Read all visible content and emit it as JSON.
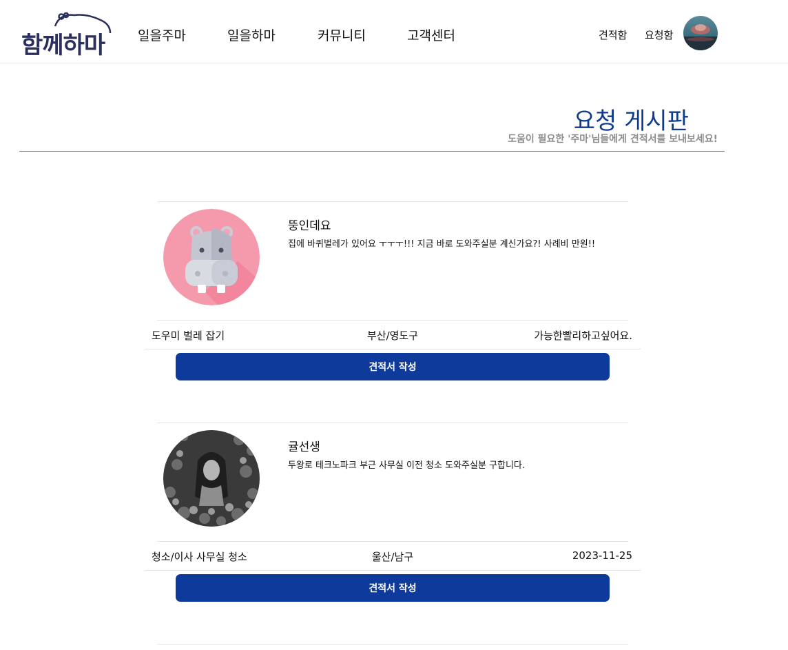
{
  "header": {
    "logo_text": "함께하마",
    "nav": [
      "일을주마",
      "일을하마",
      "커뮤니티",
      "고객센터"
    ],
    "util": [
      "견적함",
      "요청함"
    ]
  },
  "board": {
    "title": "요청 게시판",
    "subtitle": "도움이 필요한 '주마'님들에게 견적서를 보내보세요!"
  },
  "requests": [
    {
      "name": "뚱인데요",
      "description": "집에 바퀴벌레가 있어요 ㅜㅜㅜ!!! 지금 바로 도와주실분 계신가요?! 사례비 만원!!",
      "category": "도우미 벌레 잡기",
      "location": "부산/영도구",
      "time": "가능한빨리하고싶어요.",
      "button_label": "견적서 작성",
      "photo_icon": "hippo-icon"
    },
    {
      "name": "귤선생",
      "description": "두왕로 테크노파크 부근 사무실 이전 청소 도와주실분 구합니다.",
      "category": "청소/이사 사무실 청소",
      "location": "울산/남구",
      "time": "2023-11-25",
      "button_label": "견적서 작성",
      "photo_icon": "user-photo"
    }
  ],
  "colors": {
    "brand_navy": "#2b2f5c",
    "title_blue": "#0d3a8e",
    "button_blue": "#0e3a9c",
    "divider_blue": "#2a9ad6"
  }
}
